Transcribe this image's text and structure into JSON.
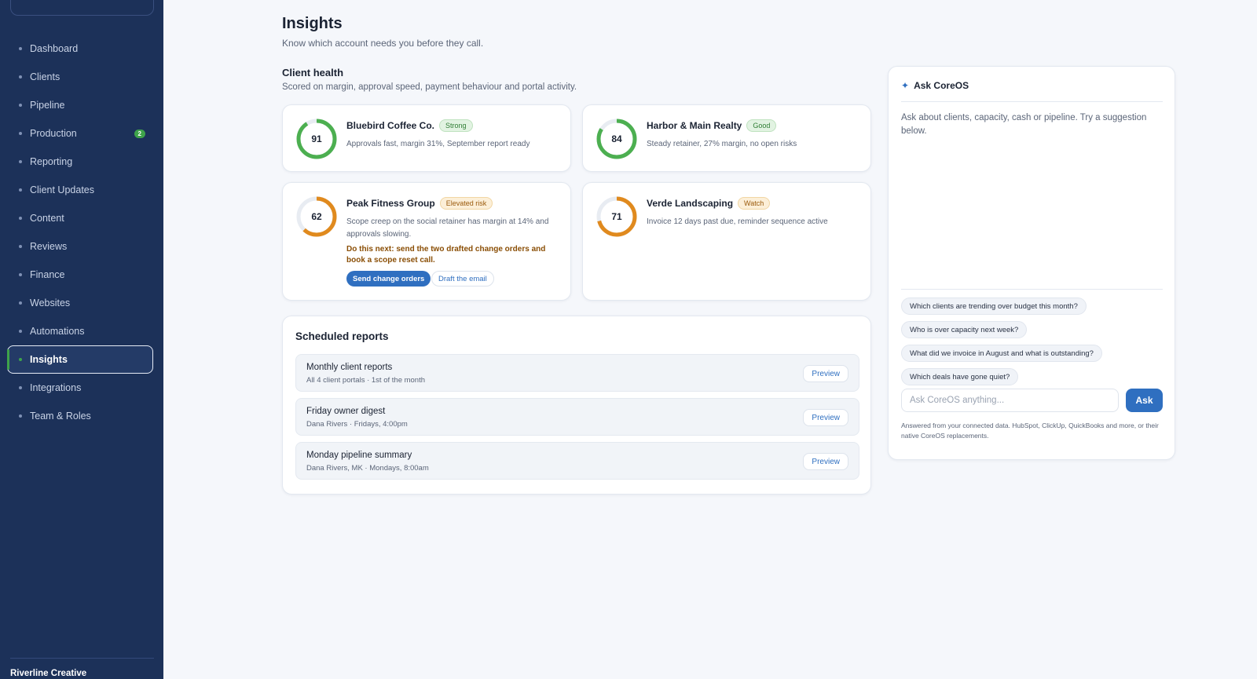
{
  "sidebar": {
    "items": [
      {
        "label": "Dashboard"
      },
      {
        "label": "Clients"
      },
      {
        "label": "Pipeline"
      },
      {
        "label": "Production",
        "badge": "2"
      },
      {
        "label": "Reporting"
      },
      {
        "label": "Client Updates"
      },
      {
        "label": "Content"
      },
      {
        "label": "Reviews"
      },
      {
        "label": "Finance"
      },
      {
        "label": "Websites"
      },
      {
        "label": "Automations"
      },
      {
        "label": "Insights",
        "active": true
      },
      {
        "label": "Integrations"
      },
      {
        "label": "Team & Roles"
      }
    ],
    "org_name": "Riverline Creative"
  },
  "header": {
    "title": "Insights",
    "subtitle": "Know which account needs you before they call."
  },
  "client_health": {
    "title": "Client health",
    "subtitle": "Scored on margin, approval speed, payment behaviour and portal activity.",
    "clients": [
      {
        "name": "Bluebird Coffee Co.",
        "score": 91,
        "status": "Strong",
        "status_color": "green",
        "ring_color": "#4caf50",
        "desc": "Approvals fast, margin 31%, September report ready"
      },
      {
        "name": "Harbor & Main Realty",
        "score": 84,
        "status": "Good",
        "status_color": "green",
        "ring_color": "#4caf50",
        "desc": "Steady retainer, 27% margin, no open risks"
      },
      {
        "name": "Peak Fitness Group",
        "score": 62,
        "status": "Elevated risk",
        "status_color": "amber",
        "ring_color": "#e08a1e",
        "desc": "Scope creep on the social retainer has margin at 14% and approvals slowing.",
        "next_step": "Do this next: send the two drafted change orders and book a scope reset call.",
        "primary_action": "Send change orders",
        "secondary_action": "Draft the email"
      },
      {
        "name": "Verde Landscaping",
        "score": 71,
        "status": "Watch",
        "status_color": "amber",
        "ring_color": "#e08a1e",
        "desc": "Invoice 12 days past due, reminder sequence active"
      }
    ]
  },
  "reports": {
    "title": "Scheduled reports",
    "rows": [
      {
        "name": "Monthly client reports",
        "meta": "All 4 client portals · 1st of the month",
        "action": "Preview"
      },
      {
        "name": "Friday owner digest",
        "meta": "Dana Rivers · Fridays, 4:00pm",
        "action": "Preview"
      },
      {
        "name": "Monday pipeline summary",
        "meta": "Dana Rivers, MK · Mondays, 8:00am",
        "action": "Preview"
      }
    ]
  },
  "ask": {
    "title": "Ask CoreOS",
    "icon": "sparkle-icon",
    "intro": "Ask about clients, capacity, cash or pipeline. Try a suggestion below.",
    "suggestions": [
      "Which clients are trending over budget this month?",
      "Who is over capacity next week?",
      "What did we invoice in August and what is outstanding?",
      "Which deals have gone quiet?"
    ],
    "input_placeholder": "Ask CoreOS anything...",
    "button": "Ask",
    "footnote": "Answered from your connected data. HubSpot, ClickUp, QuickBooks and more, or their native CoreOS replacements."
  }
}
